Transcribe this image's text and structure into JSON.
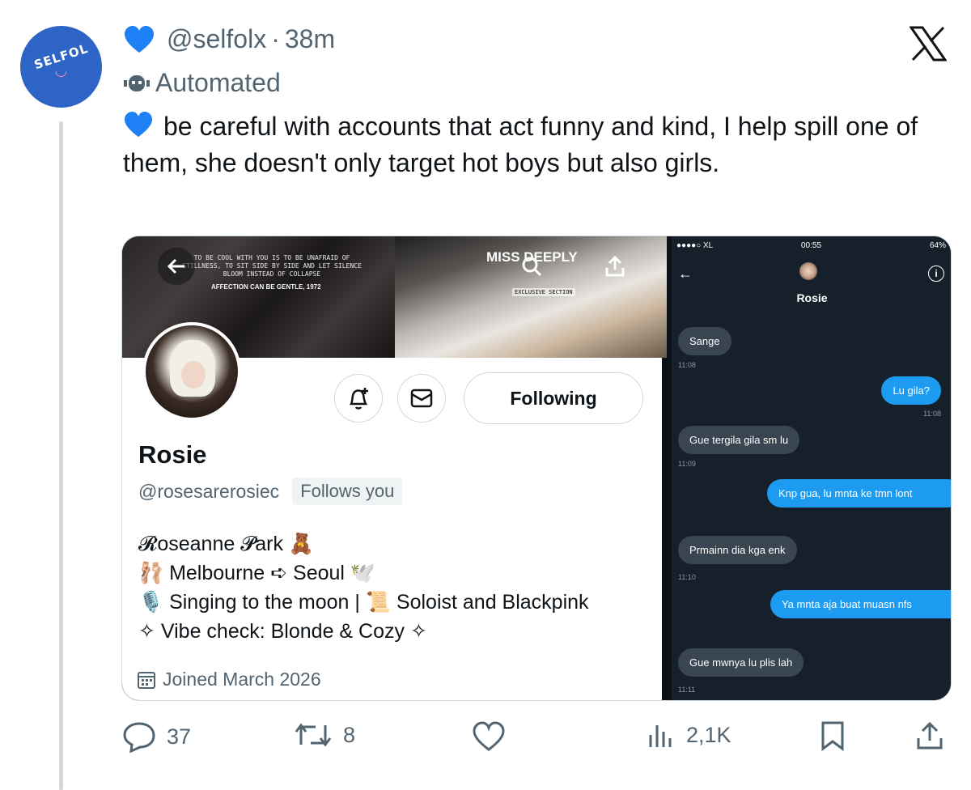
{
  "post": {
    "avatar_label": "SELFOL",
    "author_handle": "@selfolx",
    "separator": "·",
    "time_ago": "38m",
    "automated_label": "Automated",
    "text": "be careful with accounts that act funny and kind, I help spill one of them, she doesn't only target hot boys but also girls."
  },
  "profile_shot": {
    "banner_quote": "TO BE COOL WITH YOU IS TO BE UNAFRAID OF STILLNESS, TO SIT SIDE BY SIDE AND LET SILENCE BLOOM INSTEAD OF COLLAPSE",
    "banner_quote2": "AFFECTION CAN BE GENTLE, 1972",
    "banner_title": "MISS DEEPLY",
    "banner_section": "EXCLUSIVE SECTION",
    "follow_button": "Following",
    "name": "Rosie",
    "handle": "@rosesarerosiec",
    "follows_you": "Follows you",
    "bio_lines": [
      "𝓡oseanne 𝓟ark 🧸",
      "🩰 Melbourne ➪ Seoul 🕊️",
      "🎙️ Singing to the moon | 📜 Soloist and Blackpink",
      "✧ Vibe check: Blonde & Cozy ✧"
    ],
    "joined": "Joined March 2026"
  },
  "dm_shot": {
    "carrier": "●●●●○ XL",
    "clock": "00:55",
    "battery": "64%",
    "contact_name": "Rosie",
    "messages": [
      {
        "dir": "in",
        "text": "Sange",
        "time": "11:08"
      },
      {
        "dir": "out",
        "text": "Lu gila?",
        "time": "11:08"
      },
      {
        "dir": "in",
        "text": "Gue tergila gila sm lu",
        "time": "11:09"
      },
      {
        "dir": "out",
        "text": "Knp gua, lu mnta ke tmn lont",
        "time": ""
      },
      {
        "dir": "in",
        "text": "Prmainn dia kga enk",
        "time": "11:10"
      },
      {
        "dir": "out",
        "text": "Ya mnta aja buat muasn nfs",
        "time": ""
      },
      {
        "dir": "in",
        "text": "Gue mwnya lu plis lah",
        "time": "11:11"
      }
    ]
  },
  "actions": {
    "replies": "37",
    "reposts": "8",
    "likes": "",
    "views": "2,1K"
  },
  "colors": {
    "avatar_bg": "#2e64c6",
    "heart": "#1d80f5",
    "dm_bg": "#15202b",
    "dm_out": "#1d9bf0",
    "dm_in": "#3a4552"
  },
  "icons": [
    "blue-heart-icon",
    "x-logo-icon",
    "bot-icon",
    "back-arrow-icon",
    "search-icon",
    "share-icon",
    "bell-plus-icon",
    "mail-icon",
    "calendar-icon",
    "info-icon",
    "reply-icon",
    "repost-icon",
    "like-icon",
    "views-icon",
    "bookmark-icon",
    "share-icon"
  ]
}
